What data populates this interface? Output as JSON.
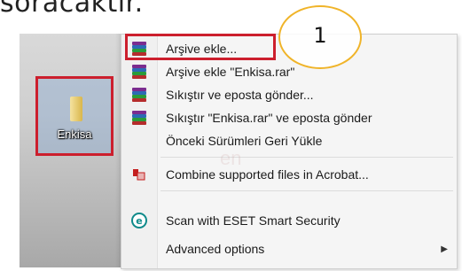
{
  "header": {
    "text": "soracaktır."
  },
  "desktop": {
    "file_label": "Enkisa"
  },
  "callout": {
    "number": "1"
  },
  "watermark": "en",
  "menu": {
    "items": [
      {
        "label": "Arşive ekle...",
        "icon": "winrar-icon"
      },
      {
        "label": "Arşive ekle \"Enkisa.rar\"",
        "icon": "winrar-icon"
      },
      {
        "label": "Sıkıştır ve eposta gönder...",
        "icon": "winrar-icon"
      },
      {
        "label": "Sıkıştır \"Enkisa.rar\" ve eposta gönder",
        "icon": "winrar-icon"
      },
      {
        "label": "Önceki Sürümleri Geri Yükle",
        "icon": ""
      },
      {
        "label": "Combine supported files in Acrobat...",
        "icon": "acrobat-icon"
      },
      {
        "label": "Scan with ESET Smart Security",
        "icon": "eset-icon"
      },
      {
        "label": "Advanced options",
        "icon": "",
        "has_submenu": true
      }
    ]
  },
  "colors": {
    "highlight_border": "#cc1f2d",
    "callout_border": "#f0b429",
    "eset_teal": "#0e8a8a",
    "acrobat_red": "#c41e1e"
  }
}
